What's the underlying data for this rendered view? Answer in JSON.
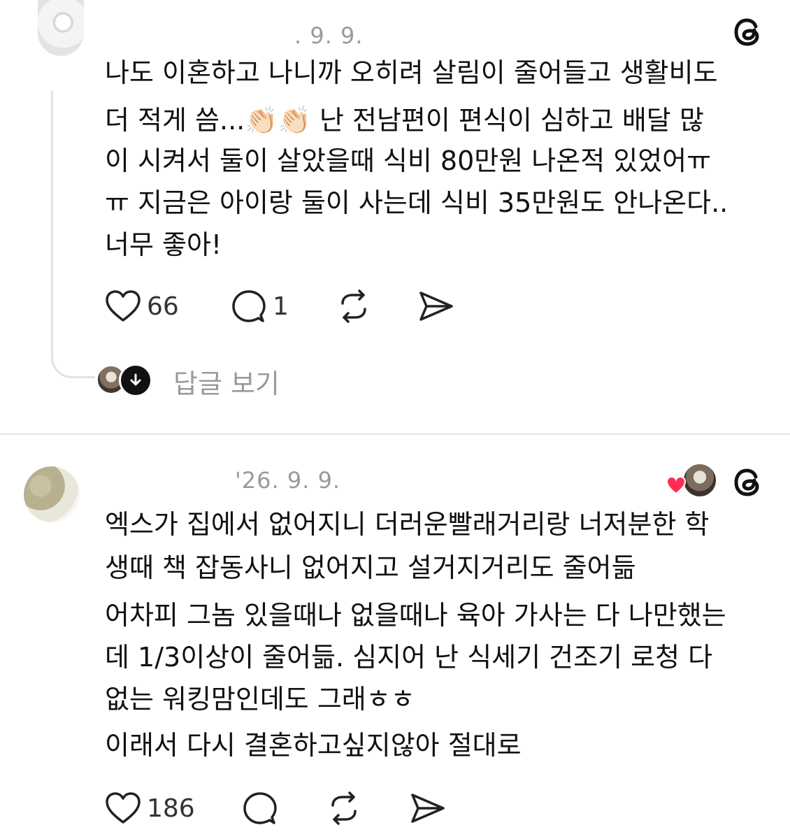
{
  "post1": {
    "date": "　. 9. 9.",
    "lines": [
      "나도 이혼하고 나니까 오히려 살림이 줄어들고 생활비도",
      "더 적게 씀...👏🏻👏🏻 난 전남편이 편식이 심하고 배달 많",
      "이 시켜서 둘이 살았을때 식비 80만원 나온적 있었어ㅠ",
      "ㅠ 지금은 아이랑 둘이 사는데 식비 35만원도 안나온다..",
      "너무 좋아!"
    ],
    "likes": "66",
    "replies": "1",
    "view_replies": "답글 보기"
  },
  "post2": {
    "date": "'26. 9. 9.",
    "lines": [
      "엑스가 집에서 없어지니 더러운빨래거리랑 너저분한 학",
      "생때 책 잡동사니 없어지고 설거지거리도 줄어듦",
      "어차피 그놈 있을때나 없을때나 육아 가사는 다 나만했는",
      "데 1/3이상이 줄어듦. 심지어 난 식세기 건조기 로청 다",
      "없는 워킹맘인데도 그래ㅎㅎ",
      "이래서 다시 결혼하고싶지않아 절대로"
    ],
    "likes": "186"
  },
  "icons": {
    "like": "heart-icon",
    "reply": "comment-bubble-icon",
    "repost": "repost-icon",
    "share": "send-icon",
    "app": "threads-logo-icon"
  },
  "colors": {
    "text": "#111111",
    "muted": "#9a9a9a",
    "liked_heart": "#ff2d55"
  }
}
